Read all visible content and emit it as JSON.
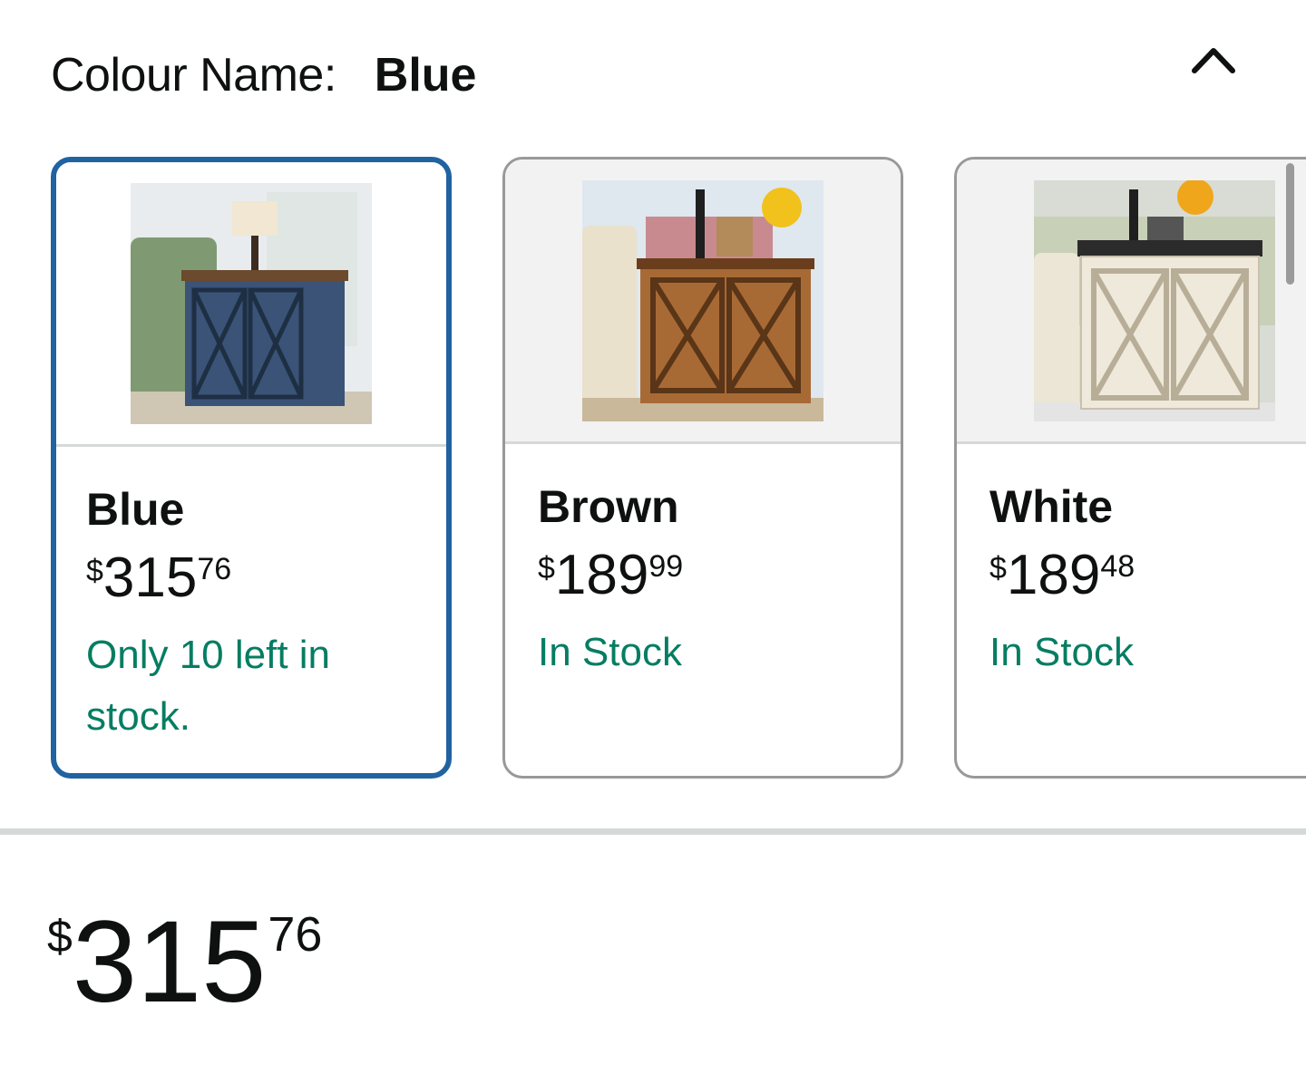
{
  "header": {
    "label": "Colour Name:",
    "selected_value": "Blue",
    "collapse_icon": "chevron-up-icon"
  },
  "options": [
    {
      "name": "Blue",
      "price_symbol": "$",
      "price_whole": "315",
      "price_fraction": "76",
      "availability": "Only 10 left in stock.",
      "selected": true,
      "cabinet_color": "#3a5377",
      "top_color": "#6b4a2e"
    },
    {
      "name": "Brown",
      "price_symbol": "$",
      "price_whole": "189",
      "price_fraction": "99",
      "availability": "In Stock",
      "selected": false,
      "cabinet_color": "#a86a35",
      "top_color": "#6a3e1c"
    },
    {
      "name": "White",
      "price_symbol": "$",
      "price_whole": "189",
      "price_fraction": "48",
      "availability": "In Stock",
      "selected": false,
      "cabinet_color": "#efe9dc",
      "top_color": "#2b2b2b"
    }
  ],
  "selected_price": {
    "symbol": "$",
    "whole": "315",
    "fraction": "76"
  },
  "colors": {
    "selected_border": "#2162a1",
    "availability_text": "#067d62"
  }
}
